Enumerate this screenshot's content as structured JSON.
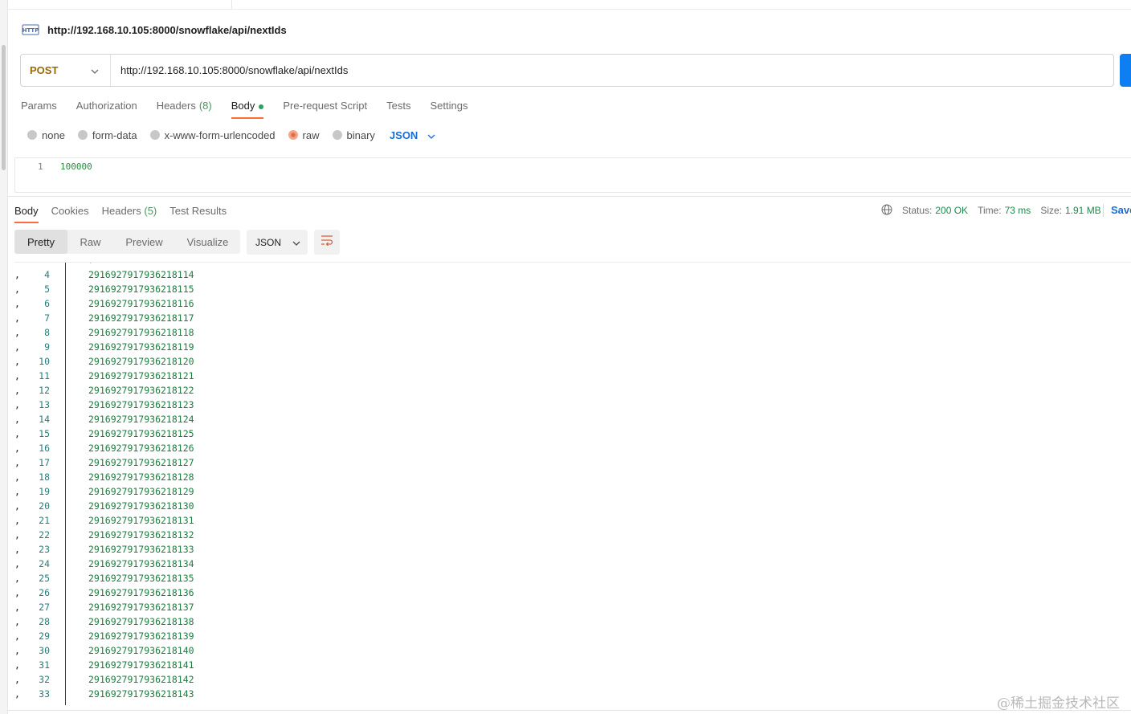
{
  "request": {
    "title": "http://192.168.10.105:8000/snowflake/api/nextIds",
    "method": "POST",
    "url": "http://192.168.10.105:8000/snowflake/api/nextIds"
  },
  "request_tabs": {
    "params": "Params",
    "authorization": "Authorization",
    "headers": "Headers",
    "headers_count": "(8)",
    "body": "Body",
    "pre_request": "Pre-request Script",
    "tests": "Tests",
    "settings": "Settings"
  },
  "body_types": {
    "none": "none",
    "form_data": "form-data",
    "urlencoded": "x-www-form-urlencoded",
    "raw": "raw",
    "binary": "binary",
    "selected_format": "JSON",
    "selected": "raw"
  },
  "editor": {
    "line_number": "1",
    "content": "100000"
  },
  "response_tabs": {
    "body": "Body",
    "cookies": "Cookies",
    "headers": "Headers",
    "headers_count": "(5)",
    "test_results": "Test Results"
  },
  "response_meta": {
    "status_label": "Status:",
    "status_value": "200 OK",
    "time_label": "Time:",
    "time_value": "73 ms",
    "size_label": "Size:",
    "size_value": "1.91 MB",
    "save": "Save"
  },
  "view_modes": {
    "pretty": "Pretty",
    "raw": "Raw",
    "preview": "Preview",
    "visualize": "Visualize",
    "format": "JSON"
  },
  "response_lines": [
    {
      "n": "4",
      "v": "2916927917936218114"
    },
    {
      "n": "5",
      "v": "2916927917936218115"
    },
    {
      "n": "6",
      "v": "2916927917936218116"
    },
    {
      "n": "7",
      "v": "2916927917936218117"
    },
    {
      "n": "8",
      "v": "2916927917936218118"
    },
    {
      "n": "9",
      "v": "2916927917936218119"
    },
    {
      "n": "10",
      "v": "2916927917936218120"
    },
    {
      "n": "11",
      "v": "2916927917936218121"
    },
    {
      "n": "12",
      "v": "2916927917936218122"
    },
    {
      "n": "13",
      "v": "2916927917936218123"
    },
    {
      "n": "14",
      "v": "2916927917936218124"
    },
    {
      "n": "15",
      "v": "2916927917936218125"
    },
    {
      "n": "16",
      "v": "2916927917936218126"
    },
    {
      "n": "17",
      "v": "2916927917936218127"
    },
    {
      "n": "18",
      "v": "2916927917936218128"
    },
    {
      "n": "19",
      "v": "2916927917936218129"
    },
    {
      "n": "20",
      "v": "2916927917936218130"
    },
    {
      "n": "21",
      "v": "2916927917936218131"
    },
    {
      "n": "22",
      "v": "2916927917936218132"
    },
    {
      "n": "23",
      "v": "2916927917936218133"
    },
    {
      "n": "24",
      "v": "2916927917936218134"
    },
    {
      "n": "25",
      "v": "2916927917936218135"
    },
    {
      "n": "26",
      "v": "2916927917936218136"
    },
    {
      "n": "27",
      "v": "2916927917936218137"
    },
    {
      "n": "28",
      "v": "2916927917936218138"
    },
    {
      "n": "29",
      "v": "2916927917936218139"
    },
    {
      "n": "30",
      "v": "2916927917936218140"
    },
    {
      "n": "31",
      "v": "2916927917936218141"
    },
    {
      "n": "32",
      "v": "2916927917936218142"
    },
    {
      "n": "33",
      "v": "2916927917936218143"
    }
  ],
  "watermark": "@稀土掘金技术社区",
  "colors": {
    "method": "#9a6a00",
    "accent": "#ff6c37",
    "send": "#0d7ff2",
    "status_ok": "#1c8a4a",
    "link": "#1a6ed1"
  },
  "icons": [
    "http-request-icon",
    "chevron-down-icon",
    "globe-icon",
    "wrap-lines-icon"
  ]
}
